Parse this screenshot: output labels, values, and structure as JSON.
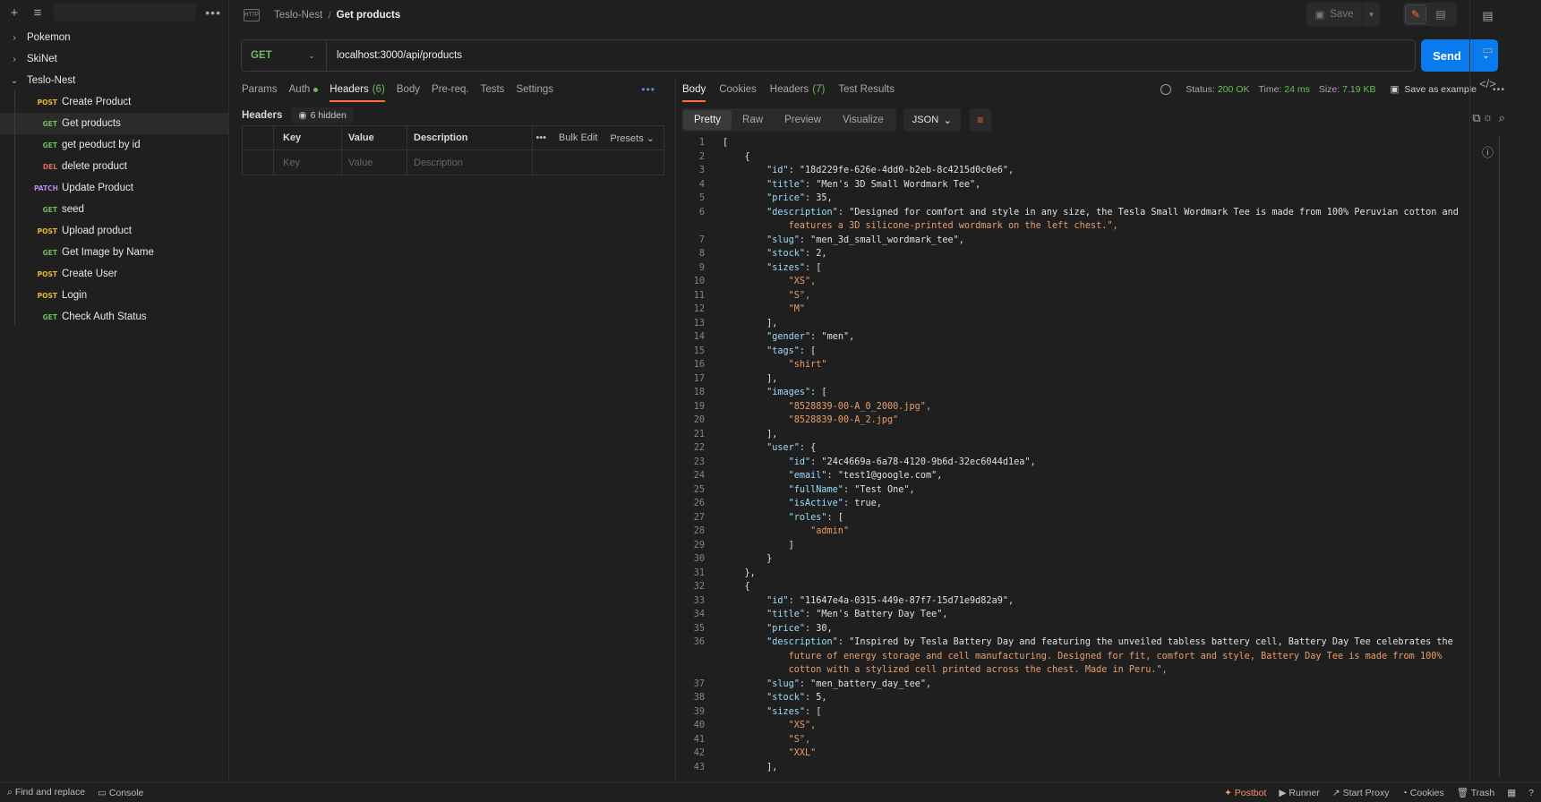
{
  "sidebar": {
    "folders": [
      {
        "name": "Pokemon",
        "expanded": false
      },
      {
        "name": "SkiNet",
        "expanded": false
      },
      {
        "name": "Teslo-Nest",
        "expanded": true
      }
    ],
    "requests": [
      {
        "method": "POST",
        "name": "Create Product"
      },
      {
        "method": "GET",
        "name": "Get products",
        "active": true
      },
      {
        "method": "GET",
        "name": "get peoduct by id"
      },
      {
        "method": "DEL",
        "name": "delete product"
      },
      {
        "method": "PATCH",
        "name": "Update Product"
      },
      {
        "method": "GET",
        "name": "seed"
      },
      {
        "method": "POST",
        "name": "Upload product"
      },
      {
        "method": "GET",
        "name": "Get Image by Name"
      },
      {
        "method": "POST",
        "name": "Create User"
      },
      {
        "method": "POST",
        "name": "Login"
      },
      {
        "method": "GET",
        "name": "Check Auth Status"
      }
    ]
  },
  "header": {
    "collection": "Teslo-Nest",
    "request_title": "Get products",
    "save_label": "Save"
  },
  "request": {
    "method": "GET",
    "url": "localhost:3000/api/products",
    "send_label": "Send",
    "tabs": [
      "Params",
      "Auth",
      "Headers",
      "Body",
      "Pre-req.",
      "Tests",
      "Settings"
    ],
    "headers_count": "(6)",
    "headers_title": "Headers",
    "hidden_label": "6 hidden",
    "table": {
      "col_key": "Key",
      "col_value": "Value",
      "col_description": "Description",
      "bulk_edit": "Bulk Edit",
      "presets": "Presets",
      "ph_key": "Key",
      "ph_value": "Value",
      "ph_description": "Description"
    }
  },
  "response": {
    "tabs": [
      "Body",
      "Cookies",
      "Headers",
      "Test Results"
    ],
    "headers_count": "(7)",
    "status_label": "Status:",
    "status_value": "200 OK",
    "time_label": "Time:",
    "time_value": "24 ms",
    "size_label": "Size:",
    "size_value": "7.19 KB",
    "save_example": "Save as example",
    "views": [
      "Pretty",
      "Raw",
      "Preview",
      "Visualize"
    ],
    "format": "JSON",
    "code_lines": [
      [
        1,
        "["
      ],
      [
        2,
        "    {"
      ],
      [
        3,
        "        \"id\": \"18d229fe-626e-4dd0-b2eb-8c4215d0c0e6\","
      ],
      [
        4,
        "        \"title\": \"Men's 3D Small Wordmark Tee\","
      ],
      [
        5,
        "        \"price\": 35,"
      ],
      [
        6,
        "        \"description\": \"Designed for comfort and style in any size, the Tesla Small Wordmark Tee is made from 100% Peruvian cotton and"
      ],
      [
        "",
        "            features a 3D silicone-printed wordmark on the left chest.\","
      ],
      [
        7,
        "        \"slug\": \"men_3d_small_wordmark_tee\","
      ],
      [
        8,
        "        \"stock\": 2,"
      ],
      [
        9,
        "        \"sizes\": ["
      ],
      [
        10,
        "            \"XS\","
      ],
      [
        11,
        "            \"S\","
      ],
      [
        12,
        "            \"M\""
      ],
      [
        13,
        "        ],"
      ],
      [
        14,
        "        \"gender\": \"men\","
      ],
      [
        15,
        "        \"tags\": ["
      ],
      [
        16,
        "            \"shirt\""
      ],
      [
        17,
        "        ],"
      ],
      [
        18,
        "        \"images\": ["
      ],
      [
        19,
        "            \"8528839-00-A_0_2000.jpg\","
      ],
      [
        20,
        "            \"8528839-00-A_2.jpg\""
      ],
      [
        21,
        "        ],"
      ],
      [
        22,
        "        \"user\": {"
      ],
      [
        23,
        "            \"id\": \"24c4669a-6a78-4120-9b6d-32ec6044d1ea\","
      ],
      [
        24,
        "            \"email\": \"test1@google.com\","
      ],
      [
        25,
        "            \"fullName\": \"Test One\","
      ],
      [
        26,
        "            \"isActive\": true,"
      ],
      [
        27,
        "            \"roles\": ["
      ],
      [
        28,
        "                \"admin\""
      ],
      [
        29,
        "            ]"
      ],
      [
        30,
        "        }"
      ],
      [
        31,
        "    },"
      ],
      [
        32,
        "    {"
      ],
      [
        33,
        "        \"id\": \"11647e4a-0315-449e-87f7-15d71e9d82a9\","
      ],
      [
        34,
        "        \"title\": \"Men's Battery Day Tee\","
      ],
      [
        35,
        "        \"price\": 30,"
      ],
      [
        36,
        "        \"description\": \"Inspired by Tesla Battery Day and featuring the unveiled tabless battery cell, Battery Day Tee celebrates the"
      ],
      [
        "",
        "            future of energy storage and cell manufacturing. Designed for fit, comfort and style, Battery Day Tee is made from 100%"
      ],
      [
        "",
        "            cotton with a stylized cell printed across the chest. Made in Peru.\","
      ],
      [
        37,
        "        \"slug\": \"men_battery_day_tee\","
      ],
      [
        38,
        "        \"stock\": 5,"
      ],
      [
        39,
        "        \"sizes\": ["
      ],
      [
        40,
        "            \"XS\","
      ],
      [
        41,
        "            \"S\","
      ],
      [
        42,
        "            \"XXL\""
      ],
      [
        43,
        "        ],"
      ]
    ]
  },
  "statusbar": {
    "find_replace": "Find and replace",
    "console": "Console",
    "postbot": "Postbot",
    "runner": "Runner",
    "start_proxy": "Start Proxy",
    "cookies": "Cookies",
    "trash": "Trash"
  },
  "colors": {
    "accent": "#ff6c37",
    "send": "#097bed",
    "get": "#6bbd5b",
    "post": "#e5b935",
    "delete": "#e06a5b",
    "patch": "#b48be0"
  }
}
